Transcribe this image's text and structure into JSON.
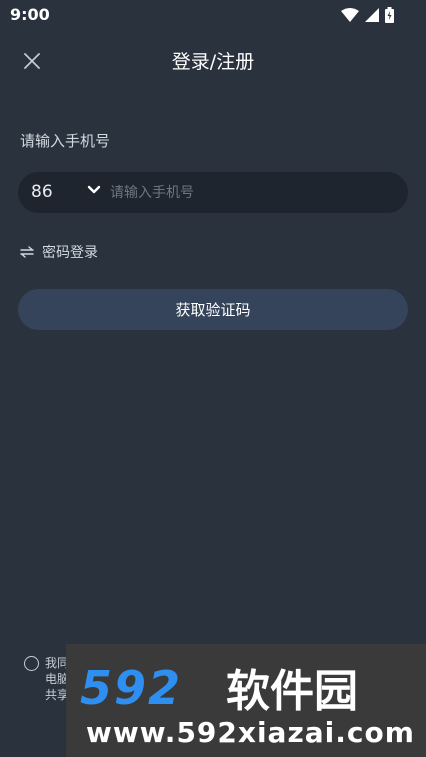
{
  "status_bar": {
    "time": "9:00",
    "icons": [
      "wifi-icon",
      "signal-icon",
      "battery-icon"
    ]
  },
  "header": {
    "title": "登录/注册",
    "close_icon": "close-icon"
  },
  "form": {
    "phone_label": "请输入手机号",
    "country_code": "86",
    "phone_placeholder": "请输入手机号",
    "phone_value": "",
    "switch_label": "密码登录",
    "get_code_button": "获取验证码"
  },
  "agreement": {
    "lines": [
      "我同",
      "电脑",
      "共享"
    ]
  },
  "watermark": {
    "logo_text": "592软件园",
    "url": "www.592xiazai.com"
  },
  "colors": {
    "background": "#29323d",
    "input_bg": "#1e252f",
    "button_bg": "#35445a",
    "watermark_blue": "#2f8ff0"
  }
}
